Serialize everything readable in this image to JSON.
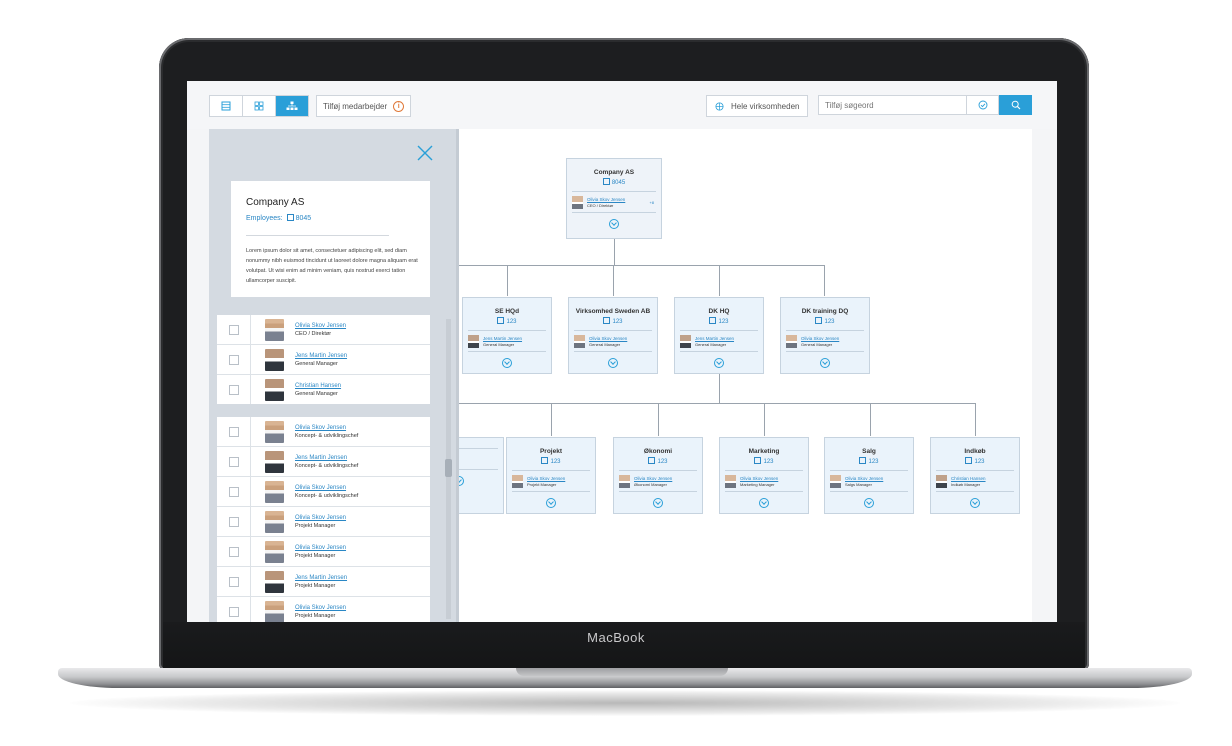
{
  "device": {
    "brand": "MacBook"
  },
  "toolbar": {
    "views": [
      "list-view-icon",
      "grid-view-icon",
      "org-chart-view-icon"
    ],
    "active_view": 2,
    "add_employees_label": "Tilføj medarbejder",
    "scope_label": "Hele virksomheden",
    "search_placeholder": "Tilføj søgeord",
    "accent": "#2a9fd8"
  },
  "panel": {
    "card": {
      "title": "Company AS",
      "employees_label": "Employees:",
      "employees_count": "8045",
      "description": "Lorem ipsum dolor sit amet, consectetuer adipiscing elit, sed diam nonummy nibh euismod tincidunt ut laoreet dolore magna aliquam erat volutpat. Ut wisi enim ad minim veniam, quis nostrud exerci tation ullamcorper suscipit."
    },
    "leaders": [
      {
        "name": "Olivia Skov Jensen",
        "role": "CEO / Direktør",
        "avatar": "f"
      },
      {
        "name": "Jens Martin Jensen",
        "role": "General Manager",
        "avatar": "m"
      },
      {
        "name": "Christian Hansen",
        "role": "General Manager",
        "avatar": "m"
      }
    ],
    "employees": [
      {
        "name": "Olivia Skov Jensen",
        "role": "Koncept- & udviklingschef",
        "avatar": "f"
      },
      {
        "name": "Jens Martin Jensen",
        "role": "Koncept- & udviklingschef",
        "avatar": "m"
      },
      {
        "name": "Olivia Skov Jensen",
        "role": "Koncept- & udviklingschef",
        "avatar": "f"
      },
      {
        "name": "Olivia Skov Jensen",
        "role": "Projekt Manager",
        "avatar": "f"
      },
      {
        "name": "Olivia Skov Jensen",
        "role": "Projekt Manager",
        "avatar": "f"
      },
      {
        "name": "Jens Martin Jensen",
        "role": "Projekt Manager",
        "avatar": "m"
      },
      {
        "name": "Olivia Skov Jensen",
        "role": "Projekt Manager",
        "avatar": "f"
      }
    ]
  },
  "org": {
    "root": {
      "title": "Company AS",
      "count": "8045",
      "manager": "Olivia Skov Jensen",
      "role": "CEO / Direktør",
      "extra": "+8"
    },
    "level1": [
      {
        "title": "SE HQd",
        "count": "123",
        "manager": "Jens Martin Jensen",
        "role": "General Manager",
        "avatar": "m"
      },
      {
        "title": "Virksomhed Sweden AB",
        "count": "123",
        "manager": "Olivia Skov Jensen",
        "role": "General Manager",
        "avatar": "f"
      },
      {
        "title": "DK HQ",
        "count": "123",
        "manager": "Jens Martin Jensen",
        "role": "General Manager",
        "avatar": "m"
      },
      {
        "title": "DK training DQ",
        "count": "123",
        "manager": "Olivia Skov Jensen",
        "role": "General Manager",
        "avatar": "f"
      }
    ],
    "level2": [
      {
        "title": "",
        "count": "",
        "manager": "",
        "role": "",
        "avatar": "f"
      },
      {
        "title": "Projekt",
        "count": "123",
        "manager": "Olivia Skov Jensen",
        "role": "Projekt Manager",
        "avatar": "f"
      },
      {
        "title": "Økonomi",
        "count": "123",
        "manager": "Olivia Skov Jensen",
        "role": "Økonomi Manager",
        "avatar": "f"
      },
      {
        "title": "Marketing",
        "count": "123",
        "manager": "Olivia Skov Jensen",
        "role": "Marketing Manager",
        "avatar": "f"
      },
      {
        "title": "Salg",
        "count": "123",
        "manager": "Olivia Skov Jensen",
        "role": "Salgs Manager",
        "avatar": "f"
      },
      {
        "title": "Indkøb",
        "count": "123",
        "manager": "Christian Hansen",
        "role": "Indkøb Manager",
        "avatar": "m"
      }
    ]
  }
}
